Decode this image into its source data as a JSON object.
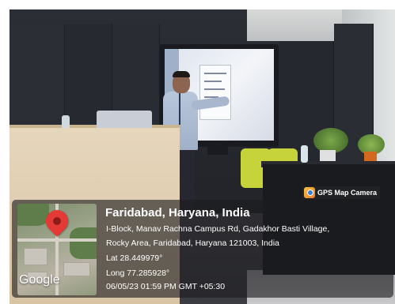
{
  "badge": {
    "label": "GPS Map Camera",
    "icon": "gps-map-camera-icon"
  },
  "location": {
    "title": "Faridabad, Haryana, India",
    "address_line1": "I-Block, Manav Rachna Campus Rd, Gadakhor Basti Village,",
    "address_line2": "Rocky Area, Faridabad, Haryana 121003, India",
    "lat": "Lat 28.449979°",
    "long": "Long 77.285928°",
    "timestamp": "06/05/23 01:59 PM GMT +05:30"
  },
  "map": {
    "logo": "Google",
    "pin_icon": "location-pin-icon",
    "pin_color": "#e53935"
  }
}
